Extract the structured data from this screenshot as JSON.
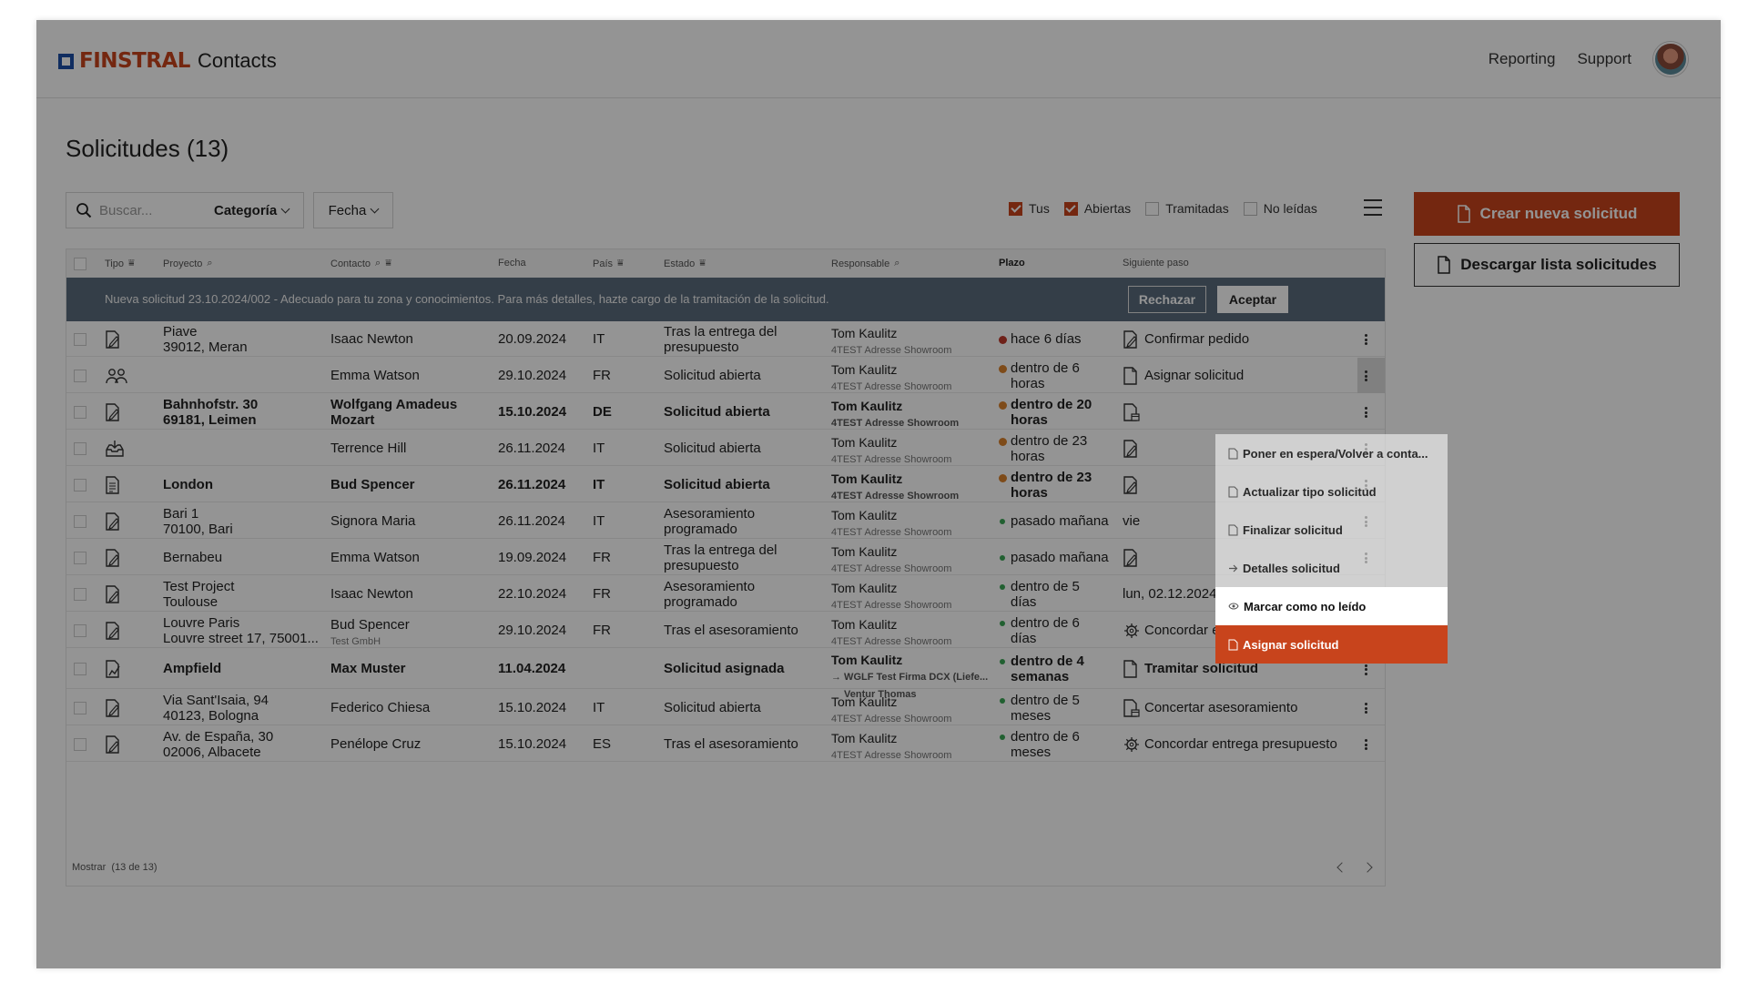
{
  "header": {
    "brand": "FINSTRAL",
    "app_name": "Contacts",
    "nav": [
      "Reporting",
      "Support"
    ],
    "avatar_icon": "user-avatar"
  },
  "page": {
    "title": "Solicitudes (13)"
  },
  "toolbar": {
    "search_placeholder": "Buscar...",
    "category_label": "Categoría",
    "date_label": "Fecha",
    "filters": [
      {
        "label": "Tus",
        "checked": true
      },
      {
        "label": "Abiertas",
        "checked": true
      },
      {
        "label": "Tramitadas",
        "checked": false
      },
      {
        "label": "No leídas",
        "checked": false
      }
    ],
    "create_button": "Crear nueva solicitud",
    "download_button": "Descargar lista solicitudes"
  },
  "table": {
    "columns": [
      "Tipo",
      "Proyecto",
      "Contacto",
      "Fecha",
      "País",
      "Estado",
      "Responsable",
      "Plazo",
      "Siguiente paso"
    ],
    "notice": {
      "text": "Nueva solicitud 23.10.2024/002 - Adecuado para tu zona y conocimientos. Para más detalles, hazte cargo de la tramitación de la solicitud.",
      "reject": "Rechazar",
      "accept": "Aceptar"
    },
    "rows": [
      {
        "icon": "document-pen-icon",
        "p1": "Piave",
        "p2": "39012, Meran",
        "contact": "Isaac Newton",
        "contact_sub": "",
        "date": "20.09.2024",
        "country": "IT",
        "status": "Tras la entrega del presupuesto",
        "resp": "Tom Kaulitz",
        "resp_sub": "4TEST Adresse Showroom",
        "deadline": "hace 6 días",
        "next": "Confirmar pedido",
        "next_icon": "document-pen-icon",
        "bold": false
      },
      {
        "icon": "people-icon",
        "p1": "",
        "p2": "",
        "contact": "Emma Watson",
        "contact_sub": "",
        "date": "29.10.2024",
        "country": "FR",
        "status": "Solicitud abierta",
        "resp": "Tom Kaulitz",
        "resp_sub": "4TEST Adresse Showroom",
        "deadline": "dentro de 6 horas",
        "next": "Asignar solicitud",
        "next_icon": "document-assign-icon",
        "bold": false
      },
      {
        "icon": "document-pen-icon",
        "p1": "Bahnhofstr. 30",
        "p2": "69181, Leimen",
        "contact": "Wolfgang Amadeus Mozart",
        "contact_sub": "",
        "date": "15.10.2024",
        "country": "DE",
        "status": "Solicitud abierta",
        "resp": "Tom Kaulitz",
        "resp_sub": "4TEST Adresse Showroom",
        "deadline": "dentro de 20 horas",
        "next": "",
        "next_icon": "document-calendar-icon",
        "bold": true
      },
      {
        "icon": "inbox-download-icon",
        "p1": "",
        "p2": "",
        "contact": "Terrence Hill",
        "contact_sub": "",
        "date": "26.11.2024",
        "country": "IT",
        "status": "Solicitud abierta",
        "resp": "Tom Kaulitz",
        "resp_sub": "4TEST Adresse Showroom",
        "deadline": "dentro de 23 horas",
        "next": "",
        "next_icon": "document-pen-icon",
        "bold": false
      },
      {
        "icon": "document-lines-icon",
        "p1": "London",
        "p2": "",
        "contact": "Bud Spencer",
        "contact_sub": "",
        "date": "26.11.2024",
        "country": "IT",
        "status": "Solicitud abierta",
        "resp": "Tom Kaulitz",
        "resp_sub": "4TEST Adresse Showroom",
        "deadline": "dentro de 23 horas",
        "next": "",
        "next_icon": "document-pen-icon",
        "bold": true
      },
      {
        "icon": "document-pen-icon",
        "p1": "Bari 1",
        "p2": "70100, Bari",
        "contact": "Signora Maria",
        "contact_sub": "",
        "date": "26.11.2024",
        "country": "IT",
        "status": "Asesoramiento programado",
        "resp": "Tom Kaulitz",
        "resp_sub": "4TEST Adresse Showroom",
        "deadline": "pasado mañana",
        "next": "vie",
        "next_icon": "",
        "bold": false
      },
      {
        "icon": "document-pen-icon",
        "p1": "Bernabeu",
        "p2": "",
        "contact": "Emma Watson",
        "contact_sub": "",
        "date": "19.09.2024",
        "country": "FR",
        "status": "Tras la entrega del presupuesto",
        "resp": "Tom Kaulitz",
        "resp_sub": "4TEST Adresse Showroom",
        "deadline": "pasado mañana",
        "next": "",
        "next_icon": "document-pen-icon",
        "bold": false
      },
      {
        "icon": "document-pen-icon",
        "p1": "Test Project",
        "p2": "Toulouse",
        "contact": "Isaac Newton",
        "contact_sub": "",
        "date": "22.10.2024",
        "country": "FR",
        "status": "Asesoramiento programado",
        "resp": "Tom Kaulitz",
        "resp_sub": "4TEST Adresse Showroom",
        "deadline": "dentro de 5 días",
        "next": "lun, 02.12.2024",
        "next_icon": "",
        "bold": false
      },
      {
        "icon": "document-pen-icon",
        "p1": "Louvre Paris",
        "p2": "Louvre street 17, 75001...",
        "contact": "Bud Spencer",
        "contact_sub": "Test GmbH",
        "date": "29.10.2024",
        "country": "FR",
        "status": "Tras el asesoramiento",
        "resp": "Tom Kaulitz",
        "resp_sub": "4TEST Adresse Showroom",
        "deadline": "dentro de 6 días",
        "next": "Concordar entrega presupuesto",
        "next_icon": "gear-people-icon",
        "bold": false
      },
      {
        "icon": "document-chart-icon",
        "p1": "Ampfield",
        "p2": "",
        "contact": "Max Muster",
        "contact_sub": "",
        "date": "11.04.2024",
        "country": "",
        "status": "Solicitud asignada",
        "resp": "Tom Kaulitz",
        "resp_sub": "→ WGLF Test Firma DCX (Liefe...",
        "resp_sub2": "Ventur Thomas",
        "deadline": "dentro de 4 semanas",
        "next": "Tramitar solicitud",
        "next_icon": "document-assign-icon",
        "bold": true
      },
      {
        "icon": "document-pen-icon",
        "p1": "Via Sant'Isaia, 94",
        "p2": "40123, Bologna",
        "contact": "Federico Chiesa",
        "contact_sub": "",
        "date": "15.10.2024",
        "country": "IT",
        "status": "Solicitud abierta",
        "resp": "Tom Kaulitz",
        "resp_sub": "4TEST Adresse Showroom",
        "deadline": "dentro de 5 meses",
        "next": "Concertar asesoramiento",
        "next_icon": "document-calendar-icon",
        "bold": false
      },
      {
        "icon": "document-pen-icon",
        "p1": "Av. de España, 30",
        "p2": "02006, Albacete",
        "contact": "Penélope Cruz",
        "contact_sub": "",
        "date": "15.10.2024",
        "country": "ES",
        "status": "Tras el asesoramiento",
        "resp": "Tom Kaulitz",
        "resp_sub": "4TEST Adresse Showroom",
        "deadline": "dentro de 6 meses",
        "next": "Concordar entrega presupuesto",
        "next_icon": "gear-people-icon",
        "bold": false
      }
    ],
    "footer": {
      "label": "Mostrar",
      "count": "(13 de 13)"
    }
  },
  "context_menu": {
    "items": [
      {
        "label": "Poner en espera/Volver a conta...",
        "icon": "document-icon"
      },
      {
        "label": "Actualizar tipo solicitud",
        "icon": "document-icon"
      },
      {
        "label": "Finalizar solicitud",
        "icon": "document-icon"
      },
      {
        "label": "Detalles solicitud",
        "icon": "arrow-right-icon"
      },
      {
        "label": "Marcar como no leído",
        "icon": "eye-icon"
      },
      {
        "label": "Asignar solicitud",
        "icon": "document-icon"
      }
    ]
  },
  "colors": {
    "accent": "#c8441c",
    "brand_blue": "#1c4fa5",
    "notice_bg": "#5a6b7c",
    "dot_orange": "#d9822b",
    "dot_red": "#c0392b",
    "dot_green": "#3aa655"
  }
}
